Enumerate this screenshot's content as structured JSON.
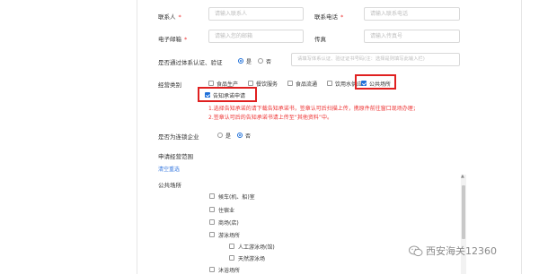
{
  "form": {
    "contact_label": "联系人",
    "contact_placeholder": "请输入联系人",
    "phone_label": "联系电话",
    "phone_placeholder": "请输入联系电话",
    "email_label": "电子邮箱",
    "email_placeholder": "请输入您的邮箱",
    "fax_label": "传真",
    "fax_placeholder": "请输入传真号",
    "cert_label": "是否通过体系认证、验证",
    "cert_yes": "是",
    "cert_no": "否",
    "cert_placeholder": "请填写体系认证、验证证书号码(注：选择是则填写此输入栏)",
    "business_label": "经营类别",
    "categories": [
      "食品生产",
      "餐饮服务",
      "食品流通",
      "饮用水供应",
      "公共场所"
    ],
    "notify_label": "告知承诺申请",
    "note1": "1.选择告知承诺的请下载告知承诺书，签章认可后扫描上传，携原件前往窗口现场办理；",
    "note2": "2.签章认可后的告知承诺书请上传至“其他资料”中。",
    "chain_label": "是否为连锁企业",
    "chain_yes": "是",
    "chain_no": "否",
    "scope_label": "申请经营范围",
    "clear_link": "清空重选",
    "public_label": "公共场所",
    "tree": [
      "候车(机、船)室",
      "住宿业",
      "商场(店)",
      "游泳场所",
      "人工游泳场(馆)",
      "天然游泳场",
      "沐浴场所"
    ]
  },
  "watermark": "西安海关12360",
  "colors": {
    "accent": "#1e6fd9",
    "required": "#e33333",
    "highlight_box": "#e02020"
  }
}
